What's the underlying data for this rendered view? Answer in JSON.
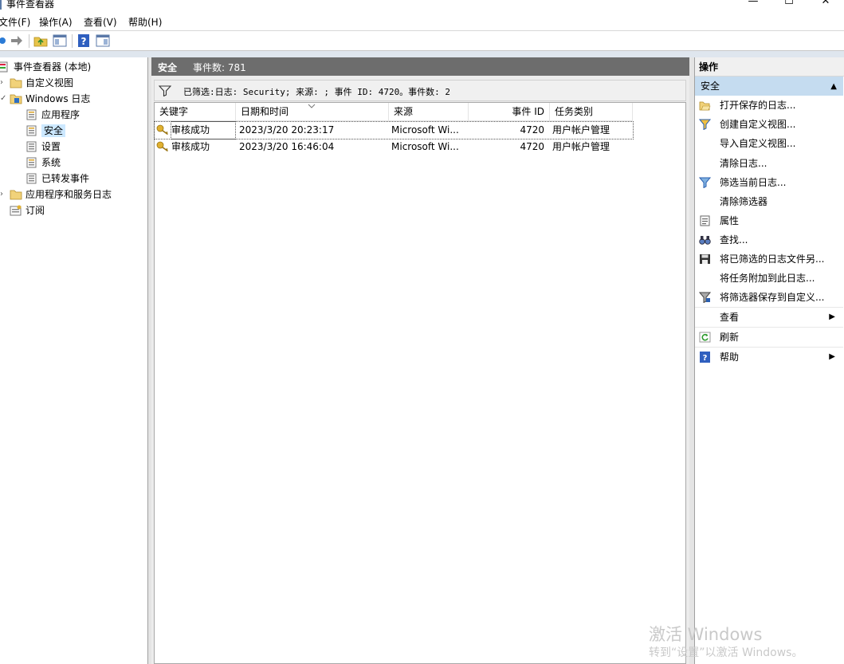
{
  "window": {
    "title": "事件查看器",
    "minimize": "—",
    "maximize": "☐",
    "close": "✕"
  },
  "menu": [
    "文件(F)",
    "操作(A)",
    "查看(V)",
    "帮助(H)"
  ],
  "toolbar": {
    "icons": [
      "back-icon",
      "forward-icon",
      "folder-up-icon",
      "show-hide-tree-icon",
      "help-icon",
      "show-hide-action-icon"
    ]
  },
  "tree": {
    "root": "事件查看器 (本地)",
    "custom_views": "自定义视图",
    "windows_logs": "Windows 日志",
    "windows_children": [
      "应用程序",
      "安全",
      "设置",
      "系统",
      "已转发事件"
    ],
    "app_services": "应用程序和服务日志",
    "subscriptions": "订阅",
    "selected": "安全"
  },
  "center": {
    "header_title": "安全",
    "header_count": "事件数: 781",
    "filter_text": "已筛选:日志: Security; 来源: ; 事件 ID: 4720。事件数: 2",
    "columns": [
      "关键字",
      "日期和时间",
      "来源",
      "事件 ID",
      "任务类别"
    ],
    "rows": [
      {
        "keyword": "审核成功",
        "datetime": "2023/3/20 20:23:17",
        "source": "Microsoft Wi...",
        "event_id": "4720",
        "category": "用户帐户管理"
      },
      {
        "keyword": "审核成功",
        "datetime": "2023/3/20 16:46:04",
        "source": "Microsoft Wi...",
        "event_id": "4720",
        "category": "用户帐户管理"
      }
    ]
  },
  "actions": {
    "title": "操作",
    "section": "安全",
    "items": [
      {
        "label": "打开保存的日志...",
        "icon": "open-folder-icon"
      },
      {
        "label": "创建自定义视图...",
        "icon": "filter-create-icon"
      },
      {
        "label": "导入自定义视图...",
        "icon": ""
      },
      {
        "label": "清除日志...",
        "icon": ""
      },
      {
        "label": "筛选当前日志...",
        "icon": "filter-icon"
      },
      {
        "label": "清除筛选器",
        "icon": ""
      },
      {
        "label": "属性",
        "icon": "properties-icon"
      },
      {
        "label": "查找...",
        "icon": "binoculars-icon"
      },
      {
        "label": "将已筛选的日志文件另...",
        "icon": "save-icon"
      },
      {
        "label": "将任务附加到此日志...",
        "icon": ""
      },
      {
        "label": "将筛选器保存到自定义...",
        "icon": "filter-save-icon"
      },
      {
        "label": "查看",
        "icon": "",
        "submenu": true
      },
      {
        "label": "刷新",
        "icon": "refresh-icon"
      },
      {
        "label": "帮助",
        "icon": "help-icon",
        "submenu": true
      }
    ]
  },
  "watermark": {
    "line1": "激活 Windows",
    "line2": "转到“设置”以激活 Windows。"
  }
}
